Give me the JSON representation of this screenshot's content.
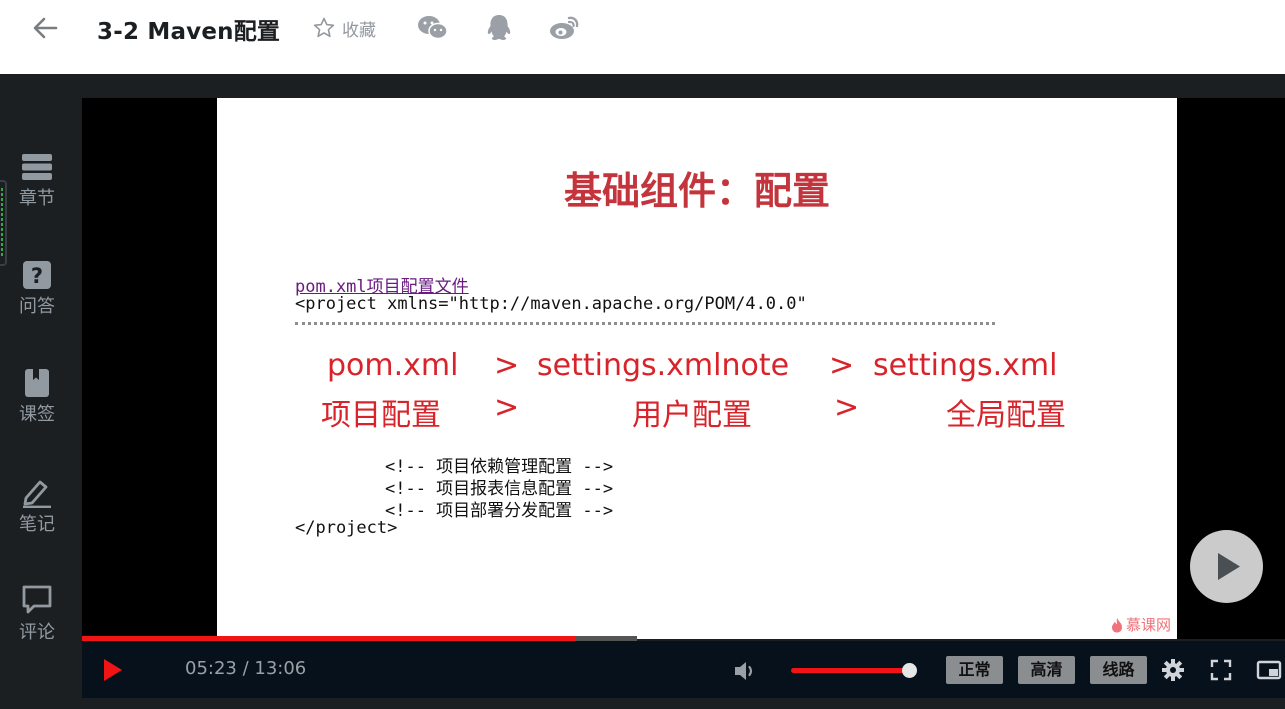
{
  "header": {
    "title": "3-2 Maven配置",
    "favorite_label": "收藏"
  },
  "sidebar": {
    "items": [
      {
        "label": "章节",
        "icon": "chapters-icon"
      },
      {
        "label": "问答",
        "icon": "question-icon"
      },
      {
        "label": "课签",
        "icon": "bookmark-icon"
      },
      {
        "label": "笔记",
        "icon": "pencil-icon"
      },
      {
        "label": "评论",
        "icon": "comment-icon"
      }
    ]
  },
  "slide": {
    "title": "基础组件：配置",
    "code_link": "pom.xml项目配置文件",
    "code_line1": "<project xmlns=\"http://maven.apache.org/POM/4.0.0\"",
    "row1": [
      "pom.xml",
      ">",
      "settings.xmlnote",
      ">",
      "settings.xml"
    ],
    "row2": [
      "项目配置",
      ">",
      "用户配置",
      ">",
      "全局配置"
    ],
    "comments": [
      "<!-- 项目依赖管理配置 -->",
      "<!-- 项目报表信息配置 -->",
      "<!-- 项目部署分发配置 -->"
    ],
    "code_end": "</project>",
    "watermark": "慕课网"
  },
  "player": {
    "time": "05:23 / 13:06",
    "progress": 0.411,
    "volume": 0.93,
    "quality_buttons": [
      "正常",
      "高清",
      "线路"
    ],
    "accent_color": "#f01414"
  }
}
